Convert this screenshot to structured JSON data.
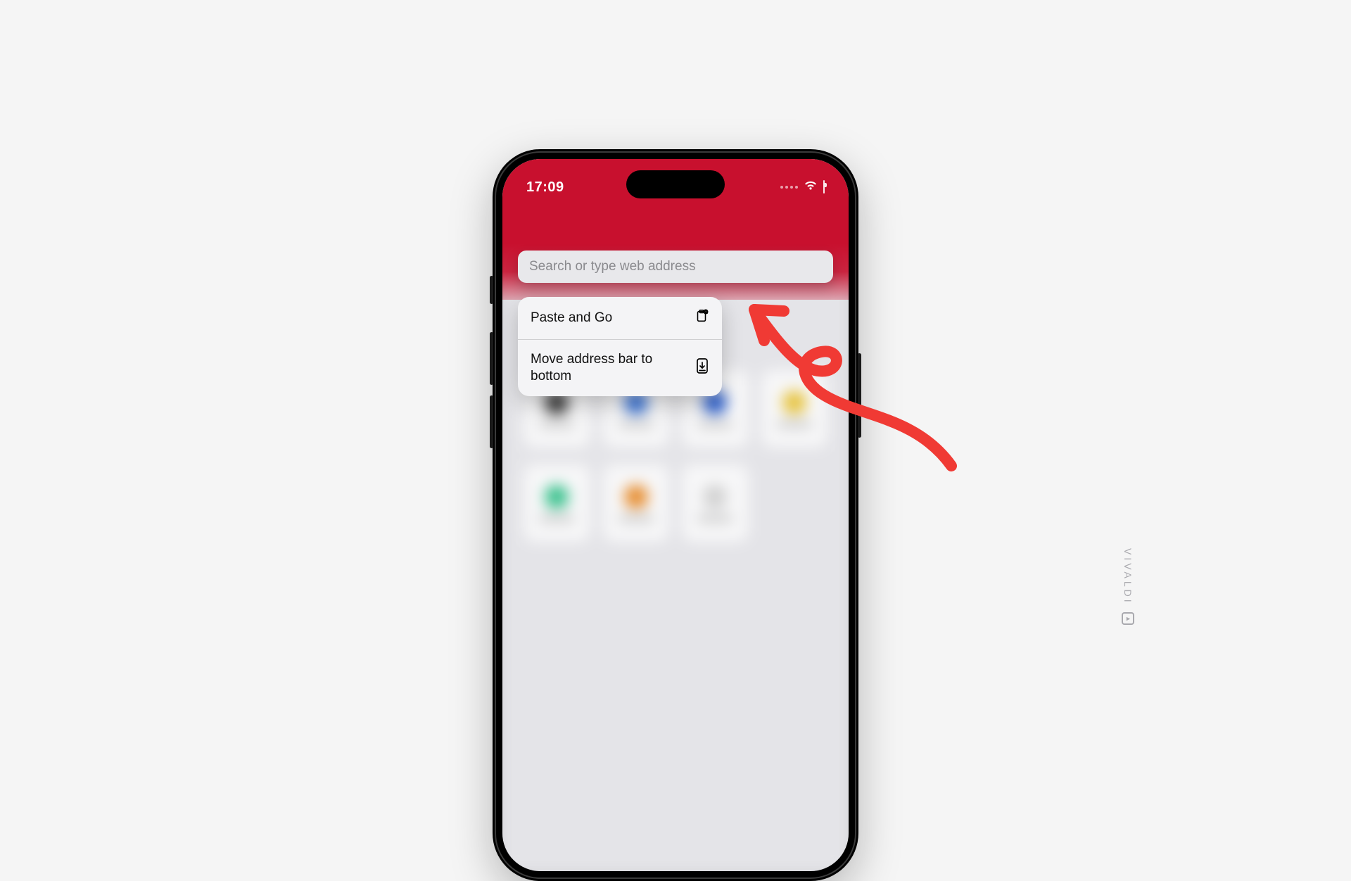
{
  "status": {
    "time": "17:09"
  },
  "addressbar": {
    "placeholder": "Search or type web address"
  },
  "menu": {
    "items": [
      {
        "label": "Paste and Go"
      },
      {
        "label": "Move address bar to bottom"
      }
    ]
  },
  "watermark": {
    "text": "VIVALDI"
  },
  "colors": {
    "accent_red": "#c8102e",
    "arrow_red": "#f03a34"
  },
  "bg_tiles": [
    "#3a3a3a",
    "#3a74d8",
    "#2a5fd0",
    "#e6c23a",
    "#34c08a",
    "#e68a2a",
    "#d0d0d0"
  ]
}
